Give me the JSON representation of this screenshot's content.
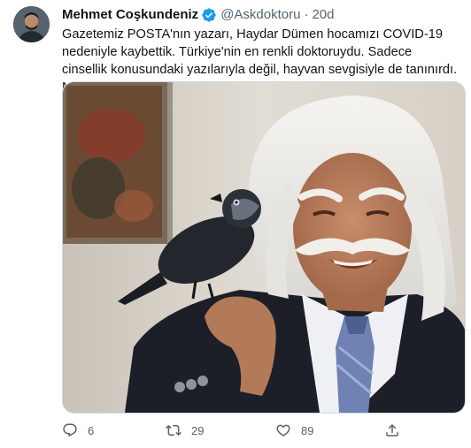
{
  "author": {
    "display_name": "Mehmet Coşkundeniz",
    "handle": "@Askdoktoru",
    "separator": "·",
    "time_ago": "20d",
    "verified": true
  },
  "tweet": {
    "text": "Gazetemiz POSTA'nın yazarı, Haydar Dümen hocamızı COVID-19 nedeniyle kaybettik. Türkiye'nin en renkli doktoruydu. Sadece cinsellik konusundaki yazılarıyla değil, hayvan sevgisiyle de tanınırdı. Nur içinde yatsın…"
  },
  "media": {
    "icon": "photo-of-man-with-bird"
  },
  "actions": {
    "reply": {
      "icon": "reply-icon",
      "count": "6"
    },
    "retweet": {
      "icon": "retweet-icon",
      "count": "29"
    },
    "like": {
      "icon": "heart-icon",
      "count": "89"
    },
    "share": {
      "icon": "share-icon"
    }
  },
  "colors": {
    "text_primary": "#0f1419",
    "text_secondary": "#536471",
    "verified_badge": "#1d9bf0",
    "border": "#cfd9de"
  }
}
